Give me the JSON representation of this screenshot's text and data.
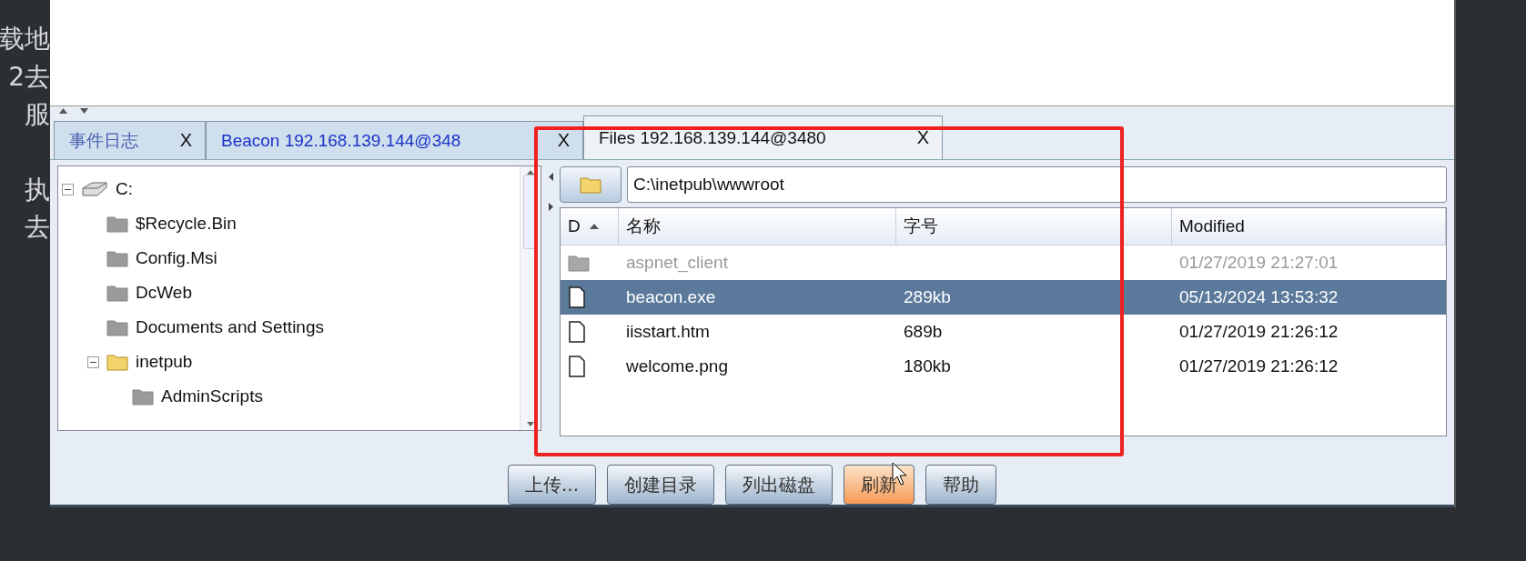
{
  "background_text": [
    [
      "载地",
      "2去",
      "服"
    ],
    [
      "执",
      "去"
    ]
  ],
  "tabs": [
    {
      "label": "事件日志",
      "close": "X",
      "selected": false,
      "kind": "log"
    },
    {
      "label": "Beacon 192.168.139.144@348",
      "close": "X",
      "selected": false,
      "kind": "beacon"
    },
    {
      "label": "Files 192.168.139.144@3480",
      "close": "X",
      "selected": true,
      "kind": "files"
    }
  ],
  "tree": [
    {
      "label": "C:",
      "kind": "drive",
      "expanded": true,
      "children": [
        {
          "label": "$Recycle.Bin",
          "kind": "folder",
          "expanded": false
        },
        {
          "label": "Config.Msi",
          "kind": "folder",
          "expanded": false
        },
        {
          "label": "DcWeb",
          "kind": "folder",
          "expanded": false
        },
        {
          "label": "Documents and Settings",
          "kind": "folder",
          "expanded": false
        },
        {
          "label": "inetpub",
          "kind": "folder",
          "expanded": true,
          "children": [
            {
              "label": "AdminScripts",
              "kind": "folder",
              "expanded": false
            }
          ]
        }
      ]
    }
  ],
  "path": {
    "value": "C:\\inetpub\\wwwroot"
  },
  "table": {
    "columns": [
      "D",
      "名称",
      "字号",
      "Modified"
    ],
    "rows": [
      {
        "kind": "folder",
        "name": "aspnet_client",
        "modified": "01/27/2019 21:27:01",
        "disabled": true,
        "selected": false
      },
      {
        "kind": "file",
        "name": "beacon.exe",
        "size": "289kb",
        "modified": "05/13/2024 13:53:32",
        "disabled": false,
        "selected": true
      },
      {
        "kind": "file",
        "name": "iisstart.htm",
        "size": "689b",
        "modified": "01/27/2019 21:26:12",
        "disabled": false,
        "selected": false
      },
      {
        "kind": "file",
        "name": "welcome.png",
        "size": "180kb",
        "modified": "01/27/2019 21:26:12",
        "disabled": false,
        "selected": false
      }
    ]
  },
  "buttons": [
    {
      "label": "上传...",
      "hovered": false
    },
    {
      "label": "创建目录",
      "hovered": false
    },
    {
      "label": "列出磁盘",
      "hovered": false
    },
    {
      "label": "刷新",
      "hovered": true
    },
    {
      "label": "帮助",
      "hovered": false
    }
  ]
}
